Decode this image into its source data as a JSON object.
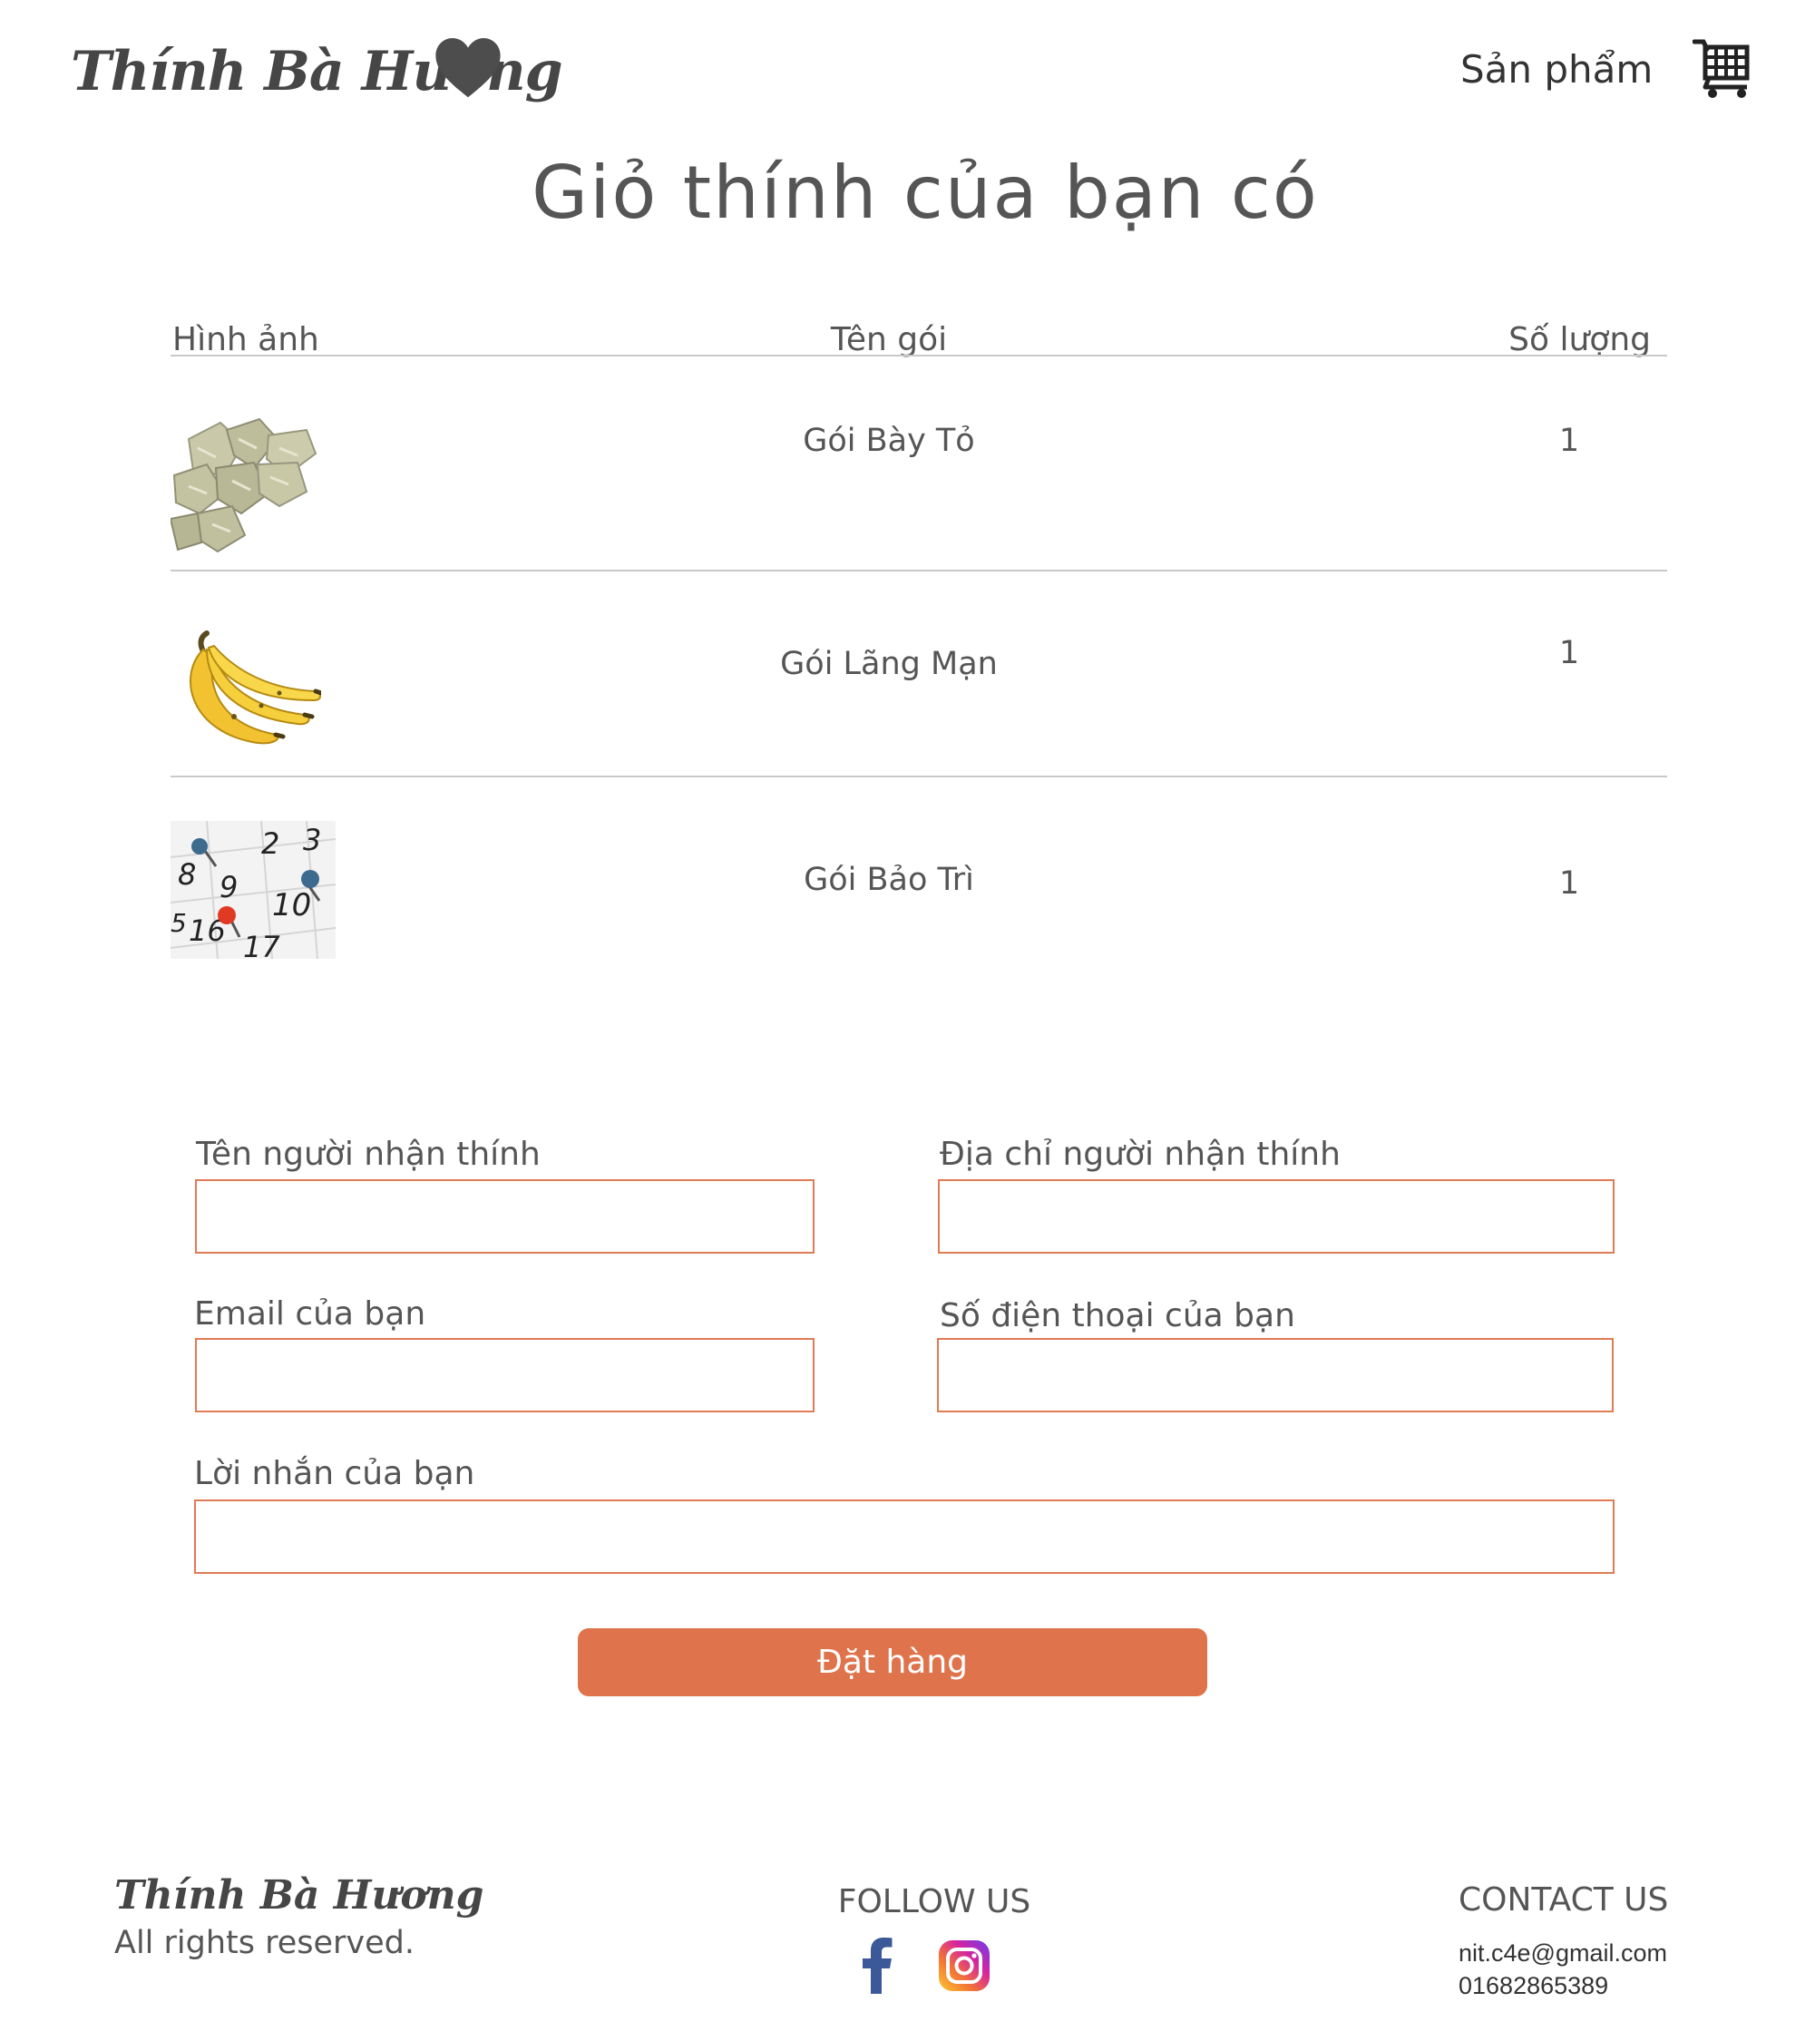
{
  "header": {
    "logo_text": "Thính Bà Hương",
    "logo_icon": "heart-icon",
    "nav_products": "Sản phẩm",
    "cart_icon": "cart-icon"
  },
  "cart": {
    "title": "Giỏ thính của bạn có",
    "columns": {
      "image": "Hình ảnh",
      "name": "Tên gói",
      "quantity": "Số lượng"
    },
    "items": [
      {
        "name": "Gói Bày Tỏ",
        "quantity": "1",
        "image_icon": "packets-image"
      },
      {
        "name": "Gói Lãng Mạn",
        "quantity": "1",
        "image_icon": "banana-image"
      },
      {
        "name": "Gói Bảo Trì",
        "quantity": "1",
        "image_icon": "calendar-image"
      }
    ]
  },
  "form": {
    "recipient_name_label": "Tên người nhận thính",
    "recipient_name_value": "",
    "recipient_address_label": "Địa chỉ người nhận thính",
    "recipient_address_value": "",
    "email_label": "Email của bạn",
    "email_value": "",
    "phone_label": "Số điện thoại của bạn",
    "phone_value": "",
    "message_label": "Lời nhắn của bạn",
    "message_value": "",
    "submit_label": "Đặt hàng"
  },
  "footer": {
    "logo_text": "Thính Bà Hương",
    "rights": "All rights reserved.",
    "follow_us": "FOLLOW US",
    "social_icons": [
      "facebook-icon",
      "instagram-icon"
    ],
    "contact_us": "CONTACT US",
    "email": "nit.c4e@gmail.com",
    "phone": "01682865389"
  },
  "colors": {
    "accent": "#de734c",
    "input_border": "#e07b55",
    "text": "#555555",
    "facebook": "#3b5998"
  }
}
